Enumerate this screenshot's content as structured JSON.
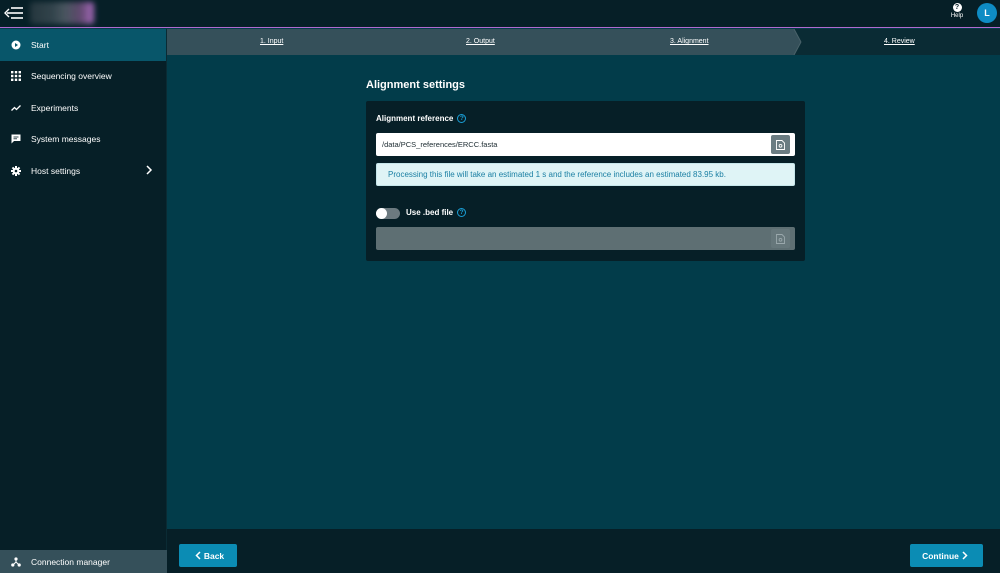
{
  "topbar": {
    "help_label": "Help",
    "help_glyph": "?",
    "avatar_initial": "L",
    "accent_line_color": "#b06ad0"
  },
  "sidebar": {
    "items": [
      {
        "label": "Start",
        "icon": "play-circle-icon",
        "active": true
      },
      {
        "label": "Sequencing overview",
        "icon": "grid-icon",
        "active": false
      },
      {
        "label": "Experiments",
        "icon": "trend-line-icon",
        "active": false
      },
      {
        "label": "System messages",
        "icon": "message-icon",
        "active": false
      },
      {
        "label": "Host settings",
        "icon": "gear-icon",
        "active": false,
        "has_chevron": true
      }
    ],
    "connection_manager": {
      "label": "Connection manager",
      "icon": "network-icon"
    }
  },
  "stepper": {
    "steps": [
      {
        "label": "1. Input",
        "state": "done"
      },
      {
        "label": "2. Output",
        "state": "done"
      },
      {
        "label": "3. Alignment",
        "state": "current"
      },
      {
        "label": "4. Review",
        "state": "todo"
      }
    ]
  },
  "main": {
    "section_title": "Alignment settings",
    "alignment_reference": {
      "label": "Alignment reference",
      "value": "/data/PCS_references/ERCC.fasta",
      "info_message": "Processing this file will take an estimated 1 s and the reference includes an estimated 83.95 kb."
    },
    "bed_file": {
      "label": "Use .bed file",
      "enabled": false,
      "value": ""
    }
  },
  "footer": {
    "back_label": "Back",
    "continue_label": "Continue"
  },
  "colors": {
    "background": "#023c4a",
    "panel": "#061f27",
    "active_nav": "#08566a",
    "primary_button": "#0b8cb4",
    "info_text": "#1a7fa3"
  }
}
